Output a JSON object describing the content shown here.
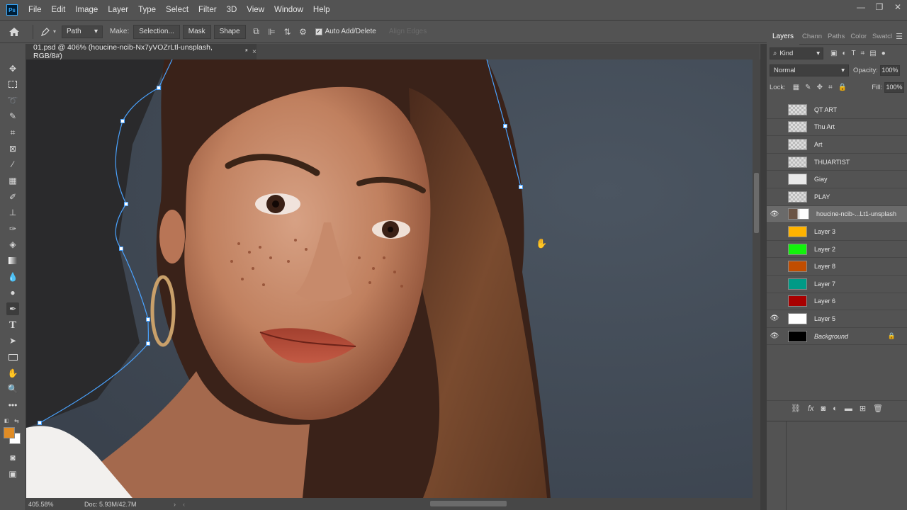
{
  "app": {
    "logo": "Ps"
  },
  "menu": [
    "File",
    "Edit",
    "Image",
    "Layer",
    "Type",
    "Select",
    "Filter",
    "3D",
    "View",
    "Window",
    "Help"
  ],
  "window_controls": {
    "minimize": "—",
    "maximize": "❐",
    "close": "✕"
  },
  "options": {
    "mode": "Path",
    "make_label": "Make:",
    "selection_btn": "Selection...",
    "mask_btn": "Mask",
    "shape_btn": "Shape",
    "auto_add_delete": "Auto Add/Delete",
    "align_edges": "Align Edges"
  },
  "document": {
    "tab_title": "01.psd @ 406% (houcine-ncib-Nx7yVOZrLtl-unsplash, RGB/8#)",
    "tab_suffix": "*",
    "zoom": "405.58%",
    "doc_info": "Doc: 5.93M/42.7M"
  },
  "panel": {
    "tabs": [
      "Layers",
      "Chann",
      "Paths",
      "Color",
      "Swatcl"
    ],
    "kind": "Kind",
    "blend_mode": "Normal",
    "opacity_label": "Opacity:",
    "opacity": "100%",
    "lock_label": "Lock:",
    "fill_label": "Fill:",
    "fill": "100%"
  },
  "layers": [
    {
      "name": "QT ART",
      "visible": false,
      "thumb": "trans"
    },
    {
      "name": "Thu Art",
      "visible": false,
      "thumb": "trans"
    },
    {
      "name": "Art",
      "visible": false,
      "thumb": "trans"
    },
    {
      "name": "THUARTIST",
      "visible": false,
      "thumb": "trans"
    },
    {
      "name": "Giay",
      "visible": false,
      "thumb": "#e8e8e8"
    },
    {
      "name": "PLAY",
      "visible": false,
      "thumb": "trans"
    },
    {
      "name": "houcine-ncib-...Lt1-unsplash",
      "visible": true,
      "thumb": "double",
      "selected": true
    },
    {
      "name": "Layer 3",
      "visible": false,
      "thumb": "#ffb300"
    },
    {
      "name": "Layer 2",
      "visible": false,
      "thumb": "#12f20c"
    },
    {
      "name": "Layer 8",
      "visible": false,
      "thumb": "#c14d00"
    },
    {
      "name": "Layer 7",
      "visible": false,
      "thumb": "#009a86"
    },
    {
      "name": "Layer 6",
      "visible": false,
      "thumb": "#a80000"
    },
    {
      "name": "Layer 5",
      "visible": true,
      "thumb": "#ffffff"
    },
    {
      "name": "Background",
      "visible": true,
      "thumb": "#000000",
      "italic": true,
      "locked": true
    }
  ],
  "colors": {
    "foreground": "#e08c25",
    "background": "#ffffff",
    "path": "#4aa3ff"
  }
}
